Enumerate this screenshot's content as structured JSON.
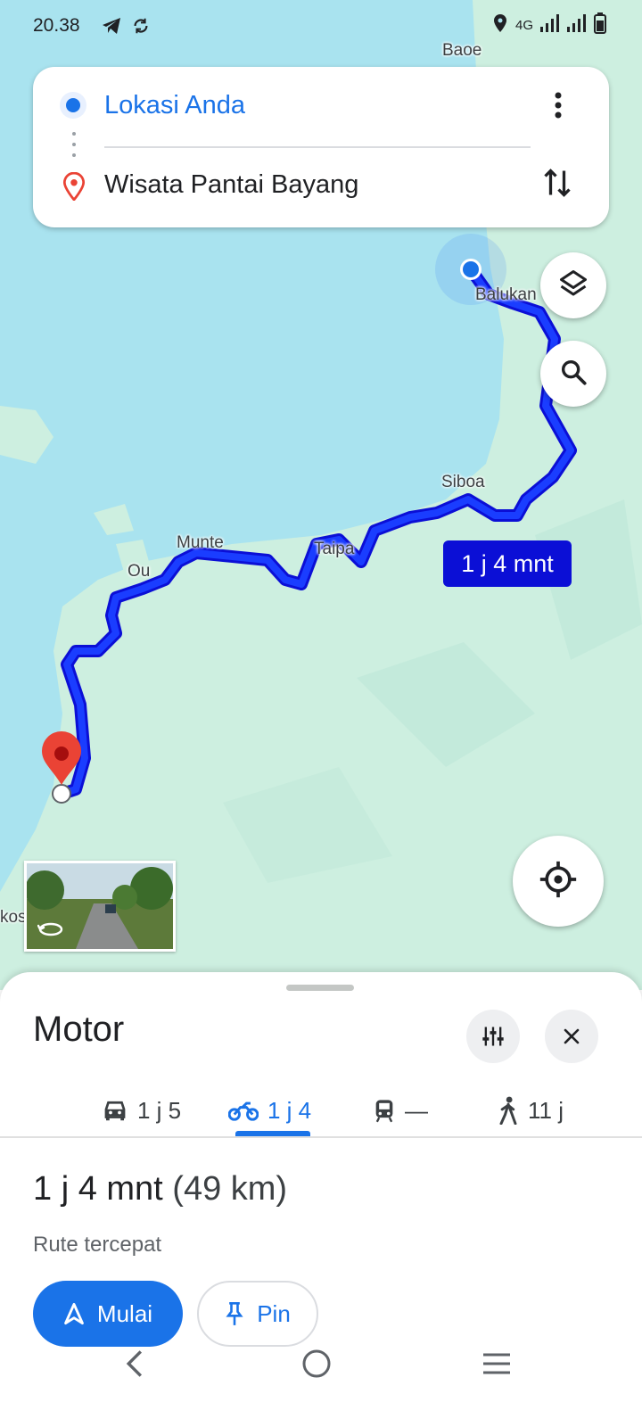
{
  "status": {
    "time": "20.38",
    "network": "4G"
  },
  "route_card": {
    "origin": "Lokasi Anda",
    "destination": "Wisata Pantai Bayang"
  },
  "map": {
    "places": [
      "Baoe",
      "Balukan",
      "Siboa",
      "Taipa",
      "Munte",
      "Ou",
      "kos"
    ],
    "eta_badge": "1 j 4 mnt",
    "route_color": "#0b0fd6",
    "water_color": "#a9e3ef",
    "land_color": "#cdefe0"
  },
  "sheet": {
    "title": "Motor",
    "tabs": [
      {
        "icon": "car-icon",
        "label": "1 j 5"
      },
      {
        "icon": "motorcycle-icon",
        "label": "1 j 4"
      },
      {
        "icon": "train-icon",
        "label": "—"
      },
      {
        "icon": "walk-icon",
        "label": "11 j"
      }
    ],
    "summary_time": "1 j 4 mnt",
    "summary_distance": "(49 km)",
    "subtitle": "Rute tercepat",
    "start_label": "Mulai",
    "pin_label": "Pin"
  }
}
